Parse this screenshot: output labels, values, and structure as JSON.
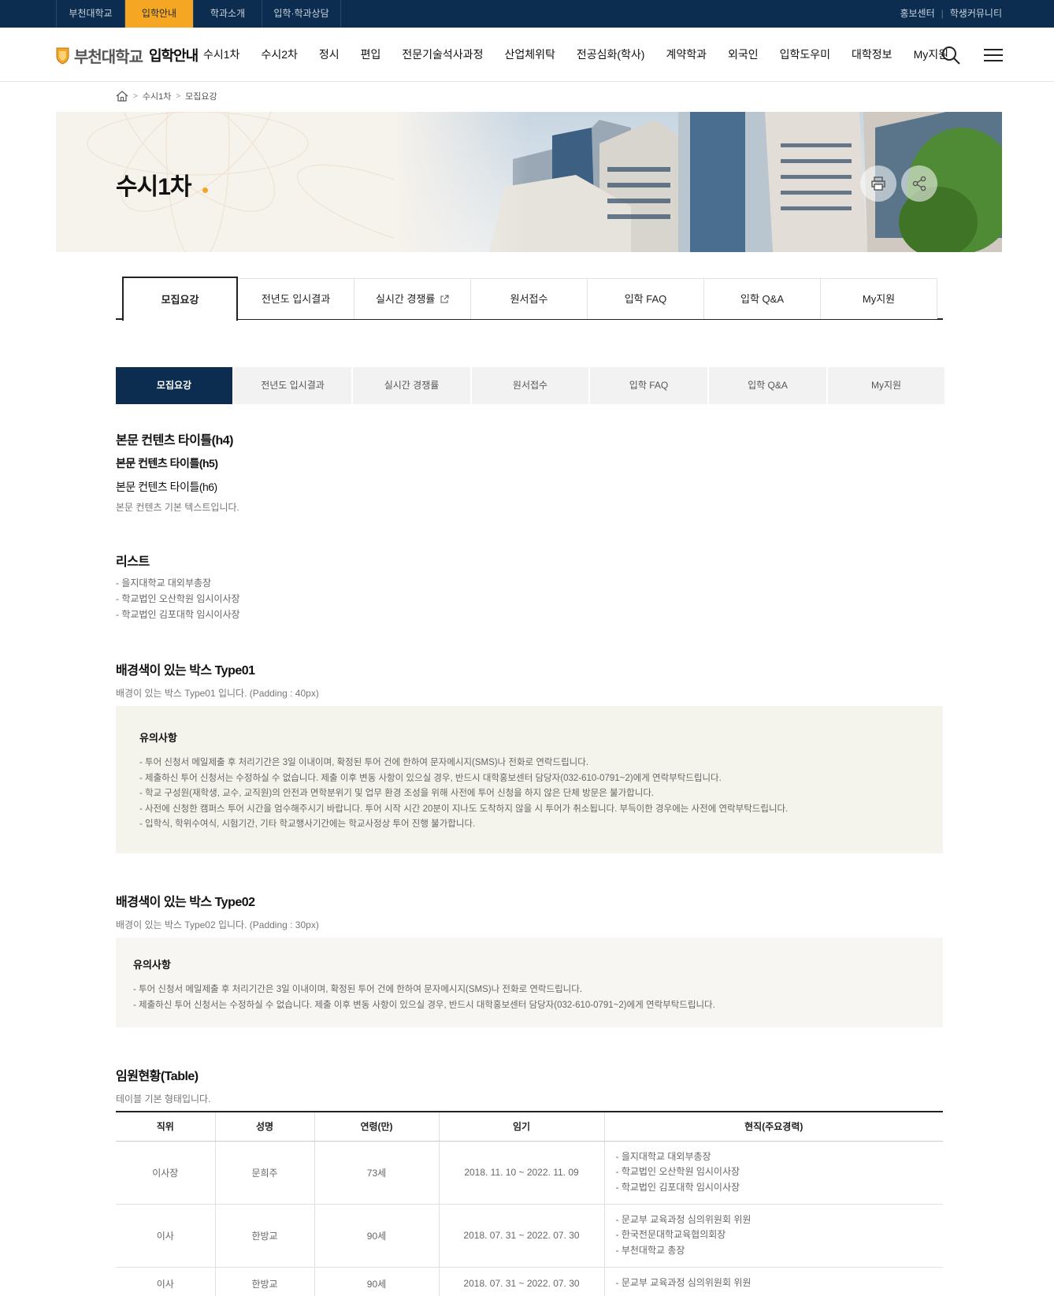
{
  "topbar": {
    "links": [
      {
        "label": "부천대학교",
        "active": false
      },
      {
        "label": "입학안내",
        "active": true
      },
      {
        "label": "학과소개",
        "active": false
      },
      {
        "label": "입학·학과상담",
        "active": false
      }
    ],
    "right": [
      "홍보센터",
      "학생커뮤니티"
    ],
    "separator": "|"
  },
  "header": {
    "logo_name": "부천대학교",
    "logo_sub": "입학안내",
    "nav": [
      "수시1차",
      "수시2차",
      "정시",
      "편입",
      "전문기술석사과정",
      "산업체위탁",
      "전공심화(학사)",
      "계약학과",
      "외국인",
      "입학도우미",
      "대학정보",
      "My지원"
    ],
    "icons": [
      "search-icon",
      "menu-icon"
    ]
  },
  "breadcrumb": {
    "items": [
      "수시1차",
      "모집요강"
    ],
    "home_icon": "home-icon",
    "arrow": ">"
  },
  "banner": {
    "title": "수시1차",
    "accent": "#f5a623",
    "buttons": [
      "print-icon",
      "share-icon"
    ]
  },
  "tabs_type1": {
    "items": [
      {
        "label": "모집요강",
        "active": true
      },
      {
        "label": "전년도 입시결과",
        "active": false
      },
      {
        "label": "실시간 경쟁률",
        "active": false,
        "external": true
      },
      {
        "label": "원서접수",
        "active": false
      },
      {
        "label": "입학 FAQ",
        "active": false
      },
      {
        "label": "입학 Q&A",
        "active": false
      },
      {
        "label": "My지원",
        "active": false
      }
    ]
  },
  "tabs_type2": {
    "items": [
      {
        "label": "모집요강",
        "active": true
      },
      {
        "label": "전년도 입시결과",
        "active": false
      },
      {
        "label": "실시간 경쟁률",
        "active": false
      },
      {
        "label": "원서접수",
        "active": false
      },
      {
        "label": "입학 FAQ",
        "active": false
      },
      {
        "label": "입학 Q&A",
        "active": false
      },
      {
        "label": "My지원",
        "active": false
      }
    ]
  },
  "content": {
    "h4": "본문 컨텐츠 타이틀(h4)",
    "h5": "본문 컨텐츠 타이틀(h5)",
    "h6": "본문 컨텐츠 타이틀(h6)",
    "body": "본문 컨텐츠 기본 텍스트입니다.",
    "list_title": "리스트",
    "list": [
      "- 을지대학교 대외부총장",
      "- 학교법인 오산학원 임시이사장",
      "- 학교법인 김포대학 임시이사장"
    ]
  },
  "box_type01": {
    "section_title": "배경색이 있는 박스 Type01",
    "section_desc": "배경이 있는 박스 Type01 입니다. (Padding : 40px)",
    "title": "유의사항",
    "lines": [
      "- 투어 신청서 메일제출 후 처리기간은 3일 이내이며, 확정된 투어 건에 한하여 문자메시지(SMS)나 전화로 연락드립니다.",
      "- 제출하신 투어 신청서는 수정하실 수 없습니다. 제출 이후 변동 사항이 있으실 경우, 반드시 대학홍보센터 담당자(032-610-0791~2)에게 연락부탁드립니다.",
      "- 학교 구성원(재학생, 교수, 교직원)의 안전과 면학분위기 및 업무 환경 조성을 위해 사전에 투어 신청을 하지 않은 단체 방문은 불가합니다.",
      "- 사전에 신청한 캠퍼스 투어 시간을 엄수해주시기 바랍니다. 투어 시작 시간 20분이 지나도 도착하지 않을 시 투어가 취소됩니다. 부득이한 경우에는 사전에 연락부탁드립니다.",
      "- 입학식, 학위수여식, 시험기간, 기타 학교행사기간에는 학교사정상 투어 진행 불가합니다."
    ],
    "background": "#f5f4ec"
  },
  "box_type02": {
    "section_title": "배경색이 있는 박스 Type02",
    "section_desc": "배경이 있는 박스 Type02 입니다. (Padding : 30px)",
    "title": "유의사항",
    "lines": [
      "- 투어 신청서 메일제출 후 처리기간은 3일 이내이며, 확정된 투어 건에 한하여 문자메시지(SMS)나 전화로 연락드립니다.",
      "- 제출하신 투어 신청서는 수정하실 수 없습니다. 제출 이후 변동 사항이 있으실 경우, 반드시 대학홍보센터 담당자(032-610-0791~2)에게 연락부탁드립니다."
    ],
    "background": "#f7f6f3"
  },
  "table": {
    "title": "임원현황(Table)",
    "desc": "테이블 기본 형태입니다.",
    "headers": [
      "직위",
      "성명",
      "연령(만)",
      "임기",
      "현직(주요경력)"
    ],
    "rows": [
      {
        "position": "이사장",
        "name": "문희주",
        "age": "73세",
        "term": "2018. 11. 10 ~ 2022. 11. 09",
        "career": [
          "- 을지대학교 대외부총장",
          "- 학교법인 오산학원 임시이사장",
          "- 학교법인 김포대학 임시이사장"
        ]
      },
      {
        "position": "이사",
        "name": "한방교",
        "age": "90세",
        "term": "2018. 07. 31 ~ 2022. 07. 30",
        "career": [
          "- 문교부 교육과정 심의위원회 위원",
          "- 한국전문대학교육협의회장",
          "- 부천대학교 총장"
        ]
      },
      {
        "position": "이사",
        "name": "한방교",
        "age": "90세",
        "term": "2018. 07. 31 ~ 2022. 07. 30",
        "career": [
          "- 문교부 교육과정 심의위원회 위원"
        ]
      }
    ]
  },
  "colors": {
    "navy": "#0c2d4f",
    "orange": "#f5a623"
  }
}
